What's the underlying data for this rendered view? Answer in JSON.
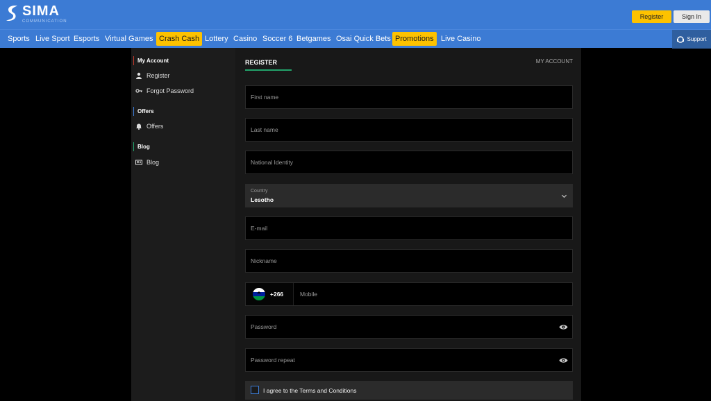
{
  "brand": {
    "name": "SIMA",
    "subtitle": "COMMUNICATION"
  },
  "header": {
    "register_label": "Register",
    "signin_label": "Sign In"
  },
  "nav": {
    "items": [
      {
        "label": "Sports"
      },
      {
        "label": "Live Sport"
      },
      {
        "label": "Esports"
      },
      {
        "label": "Virtual Games"
      },
      {
        "label": "Crash Cash",
        "highlight": true
      },
      {
        "label": "Lottery"
      },
      {
        "label": "Casino"
      },
      {
        "label": "Soccer 6"
      },
      {
        "label": "Betgames"
      },
      {
        "label": "Osai Quick Bets"
      },
      {
        "label": "Promotions",
        "highlight": true
      },
      {
        "label": "Live Casino"
      }
    ],
    "support_label": "Support"
  },
  "sidebar": {
    "sections": [
      {
        "title": "My Account",
        "items": [
          {
            "label": "Register",
            "icon": "user-icon"
          },
          {
            "label": "Forgot Password",
            "icon": "key-icon"
          }
        ]
      },
      {
        "title": "Offers",
        "items": [
          {
            "label": "Offers",
            "icon": "bell-icon"
          }
        ]
      },
      {
        "title": "Blog",
        "items": [
          {
            "label": "Blog",
            "icon": "newspaper-icon"
          }
        ]
      }
    ]
  },
  "form": {
    "title": "REGISTER",
    "my_account_link": "MY ACCOUNT",
    "first_name_placeholder": "First name",
    "last_name_placeholder": "Last name",
    "national_id_placeholder": "National Identity",
    "country_label": "Country",
    "country_value": "Lesotho",
    "email_placeholder": "E-mail",
    "nickname_placeholder": "Nickname",
    "phone_code": "+266",
    "mobile_placeholder": "Mobile",
    "password_placeholder": "Password",
    "password_repeat_placeholder": "Password repeat",
    "terms_label": "I agree to the Terms and Conditions"
  },
  "colors": {
    "header_blue": "#3c7bd4",
    "highlight_yellow": "#fdc200",
    "accent_green": "#22a36b"
  }
}
